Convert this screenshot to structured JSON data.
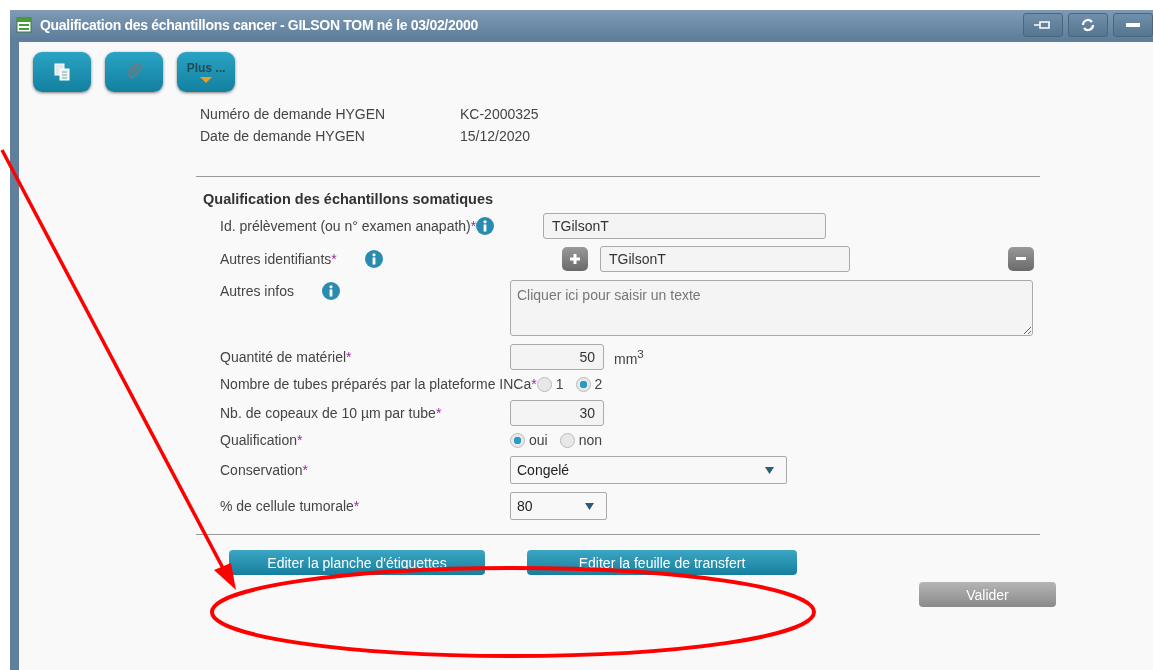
{
  "window": {
    "title": "Qualification des échantillons cancer - GILSON TOM né le 03/02/2000",
    "controls": [
      {
        "kind": "pin"
      },
      {
        "kind": "refresh"
      },
      {
        "kind": "minimize"
      }
    ]
  },
  "toolbar": [
    {
      "kind": "documents"
    },
    {
      "kind": "attach"
    },
    {
      "kind": "more",
      "label": "Plus ..."
    }
  ],
  "request_info": [
    {
      "label": "Numéro de demande HYGEN",
      "value": "KC-2000325"
    },
    {
      "label": "Date de demande HYGEN",
      "value": "15/12/2020"
    }
  ],
  "section": {
    "title": "Qualification des échantillons somatiques",
    "fields": [
      {
        "kind": "text",
        "label": "Id. prélèvement (ou n° examen anapath)",
        "required_mark": "*",
        "info": true,
        "value": "TGilsonT"
      },
      {
        "kind": "multi",
        "label": "Autres identifiants",
        "required_mark": "*",
        "info": true,
        "value": "TGilsonT"
      },
      {
        "kind": "textarea",
        "label": "Autres infos",
        "info": true,
        "placeholder": "Cliquer ici pour saisir un texte"
      },
      {
        "kind": "number",
        "label": "Quantité de matériel",
        "required_mark": "*",
        "value": "50",
        "unit": "mm$^{3}$"
      },
      {
        "kind": "radio",
        "label": "Nombre de tubes préparés par la plateforme INCa",
        "required_mark": "*",
        "options": [
          {
            "label": "1",
            "selected": false
          },
          {
            "label": "2",
            "selected": true
          }
        ]
      },
      {
        "kind": "number",
        "label": "Nb. de copeaux de 10 µm par tube",
        "required_mark": "*",
        "value": "30"
      },
      {
        "kind": "radio",
        "label": "Qualification",
        "required_mark": "*",
        "options": [
          {
            "label": "oui",
            "selected": true
          },
          {
            "label": "non",
            "selected": false
          }
        ]
      },
      {
        "kind": "select",
        "label": "Conservation",
        "required_mark": "*",
        "value": "Congelé"
      },
      {
        "kind": "short-select",
        "label": "% de cellule tumorale",
        "required_mark": "*",
        "value": "80"
      }
    ]
  },
  "actions": [
    {
      "kind": "primary",
      "label": "Editer la planche d'étiquettes"
    },
    {
      "kind": "primary",
      "label": "Editer la feuille de transfert"
    },
    {
      "kind": "secondary",
      "label": "Valider"
    }
  ],
  "annotation": {
    "kind": "arrow-ring"
  }
}
